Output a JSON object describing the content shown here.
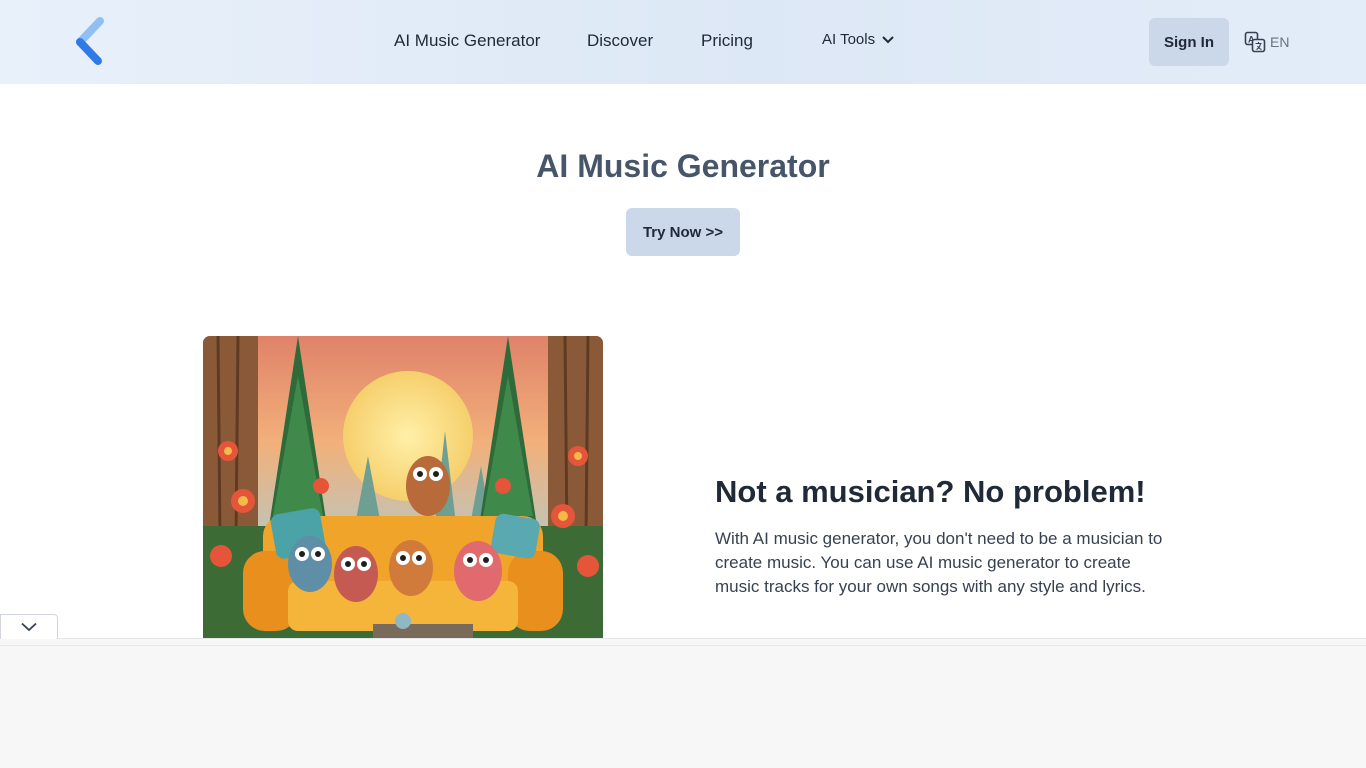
{
  "header": {
    "logo_icon": "chevron-left-logo",
    "nav": [
      {
        "label": "AI Music Generator"
      },
      {
        "label": "Discover"
      },
      {
        "label": "Pricing"
      }
    ],
    "dropdown": {
      "label": "AI Tools",
      "icon": "chevron-down-icon"
    },
    "sign_in_label": "Sign In",
    "language": {
      "icon": "translate-icon",
      "label": "EN"
    }
  },
  "hero": {
    "title": "AI Music Generator",
    "cta_label": "Try Now >>"
  },
  "feature": {
    "image_icon": "owls-on-couch-illustration",
    "title": "Not a musician? No problem!",
    "text": "With AI music generator, you don't need to be a musician to create music. You can use AI music generator to create music tracks for your own songs with any style and lyrics."
  },
  "bottom_panel": {
    "toggle_icon": "chevron-down-icon"
  },
  "colors": {
    "header_bg": "#e3ecf9",
    "button_bg": "#cbd8ea",
    "logo_light": "#7fb5f0",
    "logo_dark": "#2f7be6",
    "heading": "#475569"
  }
}
